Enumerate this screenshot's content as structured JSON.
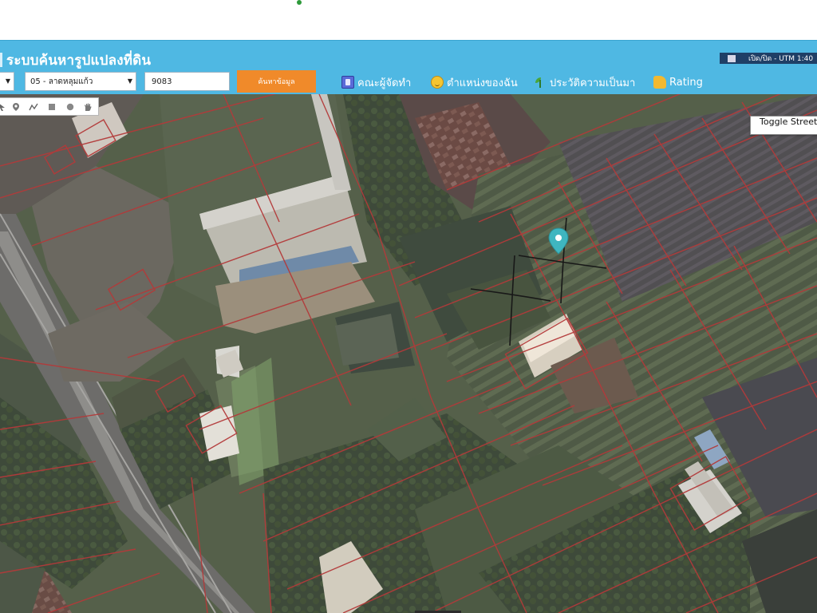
{
  "app": {
    "title": "ระบบค้นหารูปแปลงที่ดิน",
    "utm_toggle": "เปิด/ปิด - UTM 1:40"
  },
  "search": {
    "select_small_value": "",
    "district_value": "05 - ลาดหลุมแก้ว",
    "parcel_value": "9083",
    "button_label": "ค้นหาข้อมูล"
  },
  "nav": {
    "team": "คณะผู้จัดทำ",
    "position": "ตำแหน่งของฉัน",
    "history": "ประวัติความเป็นมา",
    "rating": "Rating"
  },
  "map": {
    "toggle_street_view": "Toggle Street V",
    "marker_color": "#3fb6c0",
    "parcel_line_color": "#b33a3a"
  },
  "toolbar": {
    "tools": [
      "pointer-icon",
      "marker-icon",
      "polyline-icon",
      "rectangle-icon",
      "circle-icon",
      "hand-icon"
    ]
  },
  "colors": {
    "header": "#4fb8e3",
    "search_button": "#f08a2a"
  }
}
